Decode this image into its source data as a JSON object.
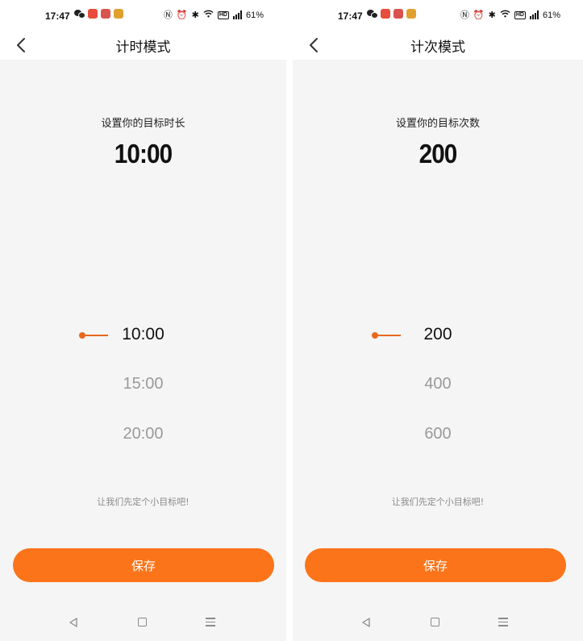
{
  "screens": [
    {
      "status": {
        "time": "17:47",
        "battery": "61%",
        "hd": "HD",
        "signal_label": "5G"
      },
      "title": "计时模式",
      "prompt": "设置你的目标时长",
      "value": "10:00",
      "options": [
        "10:00",
        "15:00",
        "20:00"
      ],
      "selected_index": 0,
      "encourage": "让我们先定个小目标吧!",
      "save_label": "保存"
    },
    {
      "status": {
        "time": "17:47",
        "battery": "61%",
        "hd": "HD",
        "signal_label": "5G"
      },
      "title": "计次模式",
      "prompt": "设置你的目标次数",
      "value": "200",
      "options": [
        "200",
        "400",
        "600"
      ],
      "selected_index": 0,
      "encourage": "让我们先定个小目标吧!",
      "save_label": "保存"
    }
  ],
  "colors": {
    "accent": "#fb7419",
    "indicator": "#e8691e",
    "background": "#f5f5f5",
    "dim_text": "#9a9a9a"
  },
  "icons": {
    "back": "chevron-left-icon",
    "sys_back": "triangle-back-icon",
    "sys_home": "square-home-icon",
    "sys_menu": "menu-lines-icon"
  }
}
